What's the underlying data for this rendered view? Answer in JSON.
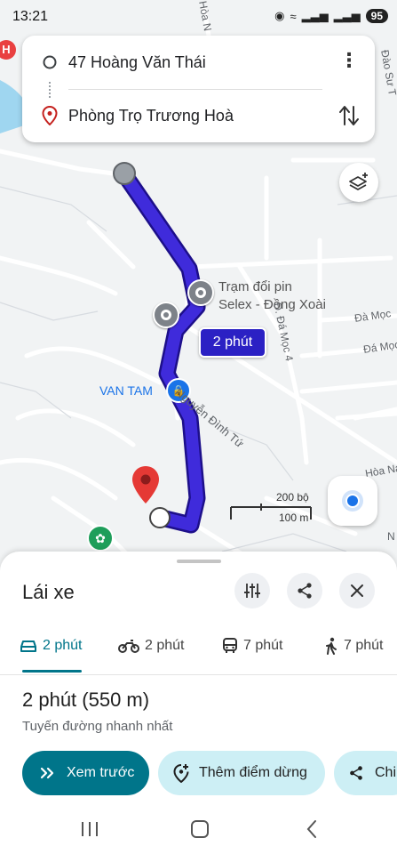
{
  "status_bar": {
    "time": "13:21",
    "battery": "95"
  },
  "route": {
    "origin": "47 Hoàng Văn Thái",
    "destination": "Phòng Trọ Trương Hoà"
  },
  "map": {
    "route_time_badge": "2 phút",
    "poi_station_line1": "Trạm đổi pin",
    "poi_station_line2": "Selex - Đồng Xoài",
    "poi_shop": "VAN TAM",
    "streets": [
      "Nguyễn Đình Tứ",
      "Đ. Đá Mọc 4",
      "Đà Mọc",
      "Đá Mọc",
      "Đào Sư T",
      "Hòa N",
      "Hòa Na",
      "N"
    ],
    "scale_ft": "200 bộ",
    "scale_m": "100 m",
    "route_color": "#3f2bdb"
  },
  "sheet": {
    "title": "Lái xe",
    "tabs": [
      {
        "mode": "car",
        "label": "2 phút"
      },
      {
        "mode": "motorbike",
        "label": "2 phút"
      },
      {
        "mode": "transit",
        "label": "7 phút"
      },
      {
        "mode": "walk",
        "label": "7 phút"
      }
    ],
    "summary": "2 phút (550 m)",
    "subtitle": "Tuyến đường nhanh nhất",
    "chips": {
      "preview": "Xem trước",
      "add_stop": "Thêm điểm dừng",
      "share": "Chi"
    },
    "accent_color": "#00758a"
  }
}
